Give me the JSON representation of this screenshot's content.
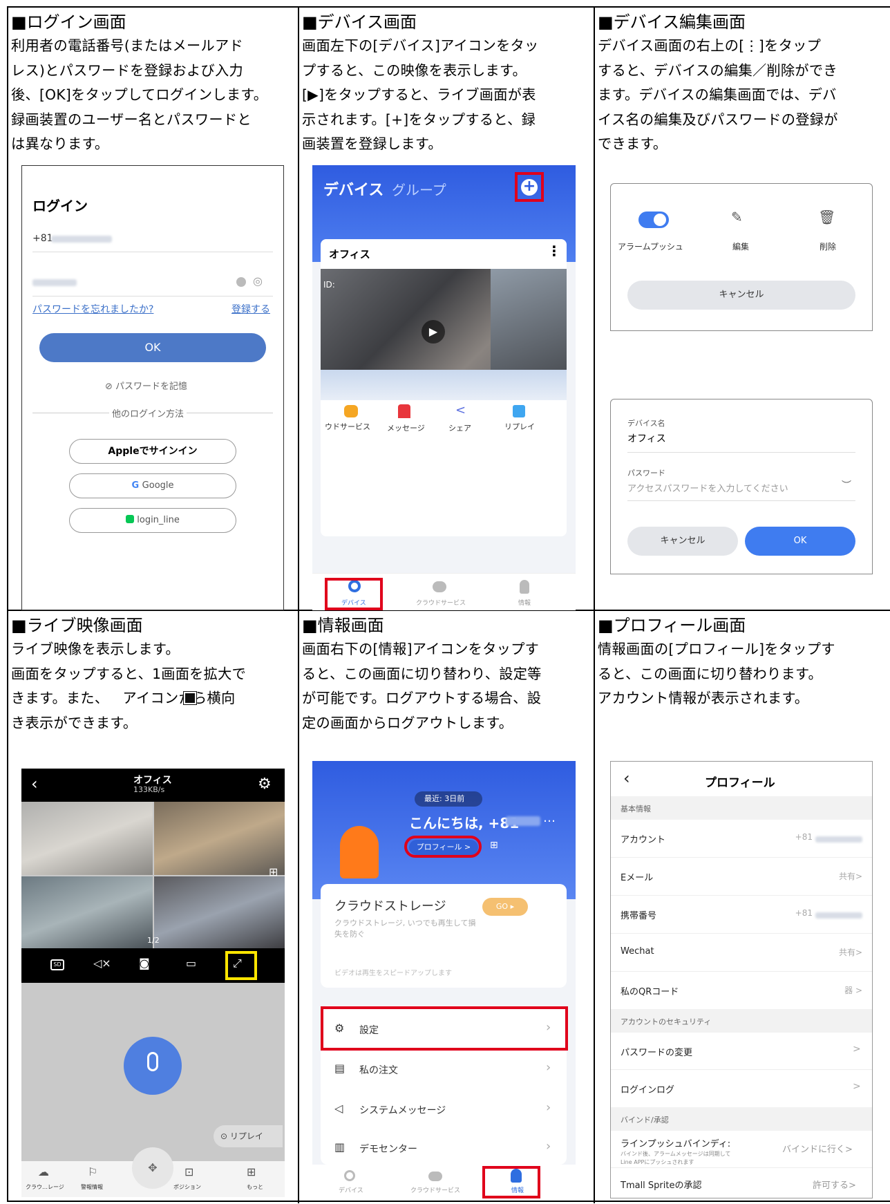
{
  "cells": [
    {
      "title": "■ログイン画面",
      "text": "利用者の電話番号(またはメールアド\nレス)とパスワードを登録および入力\n後、[OK]をタップしてログインします。\n録画装置のユーザー名とパスワードと\nは異なります。"
    },
    {
      "title": "■デバイス画面",
      "text": "画面左下の[デバイス]アイコンをタッ\nプすると、この映像を表示します。\n[▶]をタップすると、ライブ画面が表\n示されます。[+]をタップすると、録\n画装置を登録します。"
    },
    {
      "title": "■デバイス編集画面",
      "text": "デバイス画面の右上の[⋮]をタップ\nすると、デバイスの編集／削除ができ\nます。デバイスの編集画面では、デバ\nイス名の編集及びパスワードの登録が\nできます。"
    },
    {
      "title": "■ライブ映像画面",
      "text": "ライブ映像を表示します。\n画面をタップすると、1画面を拡大で\nきます。また、   アイコンから横向\nき表示ができます。"
    },
    {
      "title": "■情報画面",
      "text": "画面右下の[情報]アイコンをタップす\nると、この画面に切り替わり、設定等\nが可能です。ログアウトする場合、設\n定の画面からログアウトします。"
    },
    {
      "title": "■プロフィール画面",
      "text": "情報画面の[プロフィール]をタップす\nると、この画面に切り替わります。\nアカウント情報が表示されます。"
    }
  ],
  "login": {
    "title": "ログイン",
    "phone_prefix": "+81",
    "forgot": "パスワードを忘れましたか?",
    "register": "登録する",
    "ok": "OK",
    "remember": "パスワードを記憶",
    "other": "他のログイン方法",
    "apple": "Appleでサインイン",
    "google": "Google",
    "line": "login_line"
  },
  "device": {
    "tab1": "デバイス",
    "tab2": "グループ",
    "card_title": "オフィス",
    "id_label": "ID:",
    "actions": [
      "ウドサービス",
      "メッセージ",
      "シェア",
      "リプレイ"
    ],
    "bottom": [
      "デバイス",
      "クラウドサービス",
      "情報"
    ]
  },
  "edit": {
    "push": "アラームプッシュ",
    "edit": "編集",
    "delete": "削除",
    "cancel": "キャンセル",
    "name_label": "デバイス名",
    "name_value": "オフィス",
    "pw_label": "パスワード",
    "pw_placeholder": "アクセスパスワードを入力してください",
    "cancel2": "キャンセル",
    "ok": "OK"
  },
  "live": {
    "title": "オフィス",
    "rate": "133KB/s",
    "page": "1/2",
    "sd": "SD",
    "replay": "リプレイ",
    "bottom": [
      "クラウ…レージ",
      "警報情報",
      "ポジション",
      "もっと"
    ]
  },
  "info": {
    "recent": "最近: 3日前",
    "greeting": "こんにちは, +81",
    "profile": "プロフィール >",
    "cloud_title": "クラウドストレージ",
    "cloud_desc1": "クラウドストレージ, いつでも再生して損",
    "cloud_desc2": "失を防ぐ",
    "go": "GO ▸",
    "speed": "ビデオは再生をスピードアップします",
    "menu": [
      "設定",
      "私の注文",
      "システムメッセージ",
      "デモセンター"
    ],
    "bottom": [
      "デバイス",
      "クラウドサービス",
      "情報"
    ]
  },
  "profile": {
    "title": "プロフィール",
    "sec1": "基本情報",
    "rows1": [
      {
        "label": "アカウント",
        "value": "+81"
      },
      {
        "label": "Eメール",
        "value": "共有>"
      },
      {
        "label": "携帯番号",
        "value": "+81"
      },
      {
        "label": "Wechat",
        "value": "共有>"
      },
      {
        "label": "私のQRコード",
        "value": "器 >"
      }
    ],
    "sec2": "アカウントのセキュリティ",
    "rows2": [
      {
        "label": "パスワードの変更",
        "value": ">"
      },
      {
        "label": "ログインログ",
        "value": ">"
      }
    ],
    "sec3": "バインド/承認",
    "line_bind": "ラインプッシュバインディ:",
    "line_bind_value": "バインドに行く>",
    "line_desc1": "バインド後、アラームメッセージは同期して",
    "line_desc2": "Line APPにプッシュされます",
    "tmall": "Tmall Spriteの承認",
    "tmall_value": "許可する>"
  }
}
